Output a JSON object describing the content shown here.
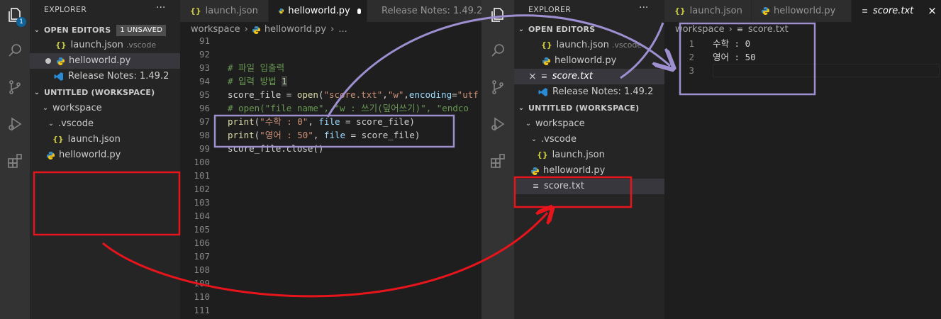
{
  "left": {
    "explorer": {
      "title": "EXPLORER",
      "more": "···"
    },
    "open_editors": {
      "label": "OPEN EDITORS",
      "badge": "1 UNSAVED",
      "items": [
        {
          "name": "launch.json",
          "hint": ".vscode"
        },
        {
          "name": "helloworld.py"
        },
        {
          "name": "Release Notes: 1.49.2"
        }
      ]
    },
    "workspace": {
      "label": "UNTITLED (WORKSPACE)",
      "items": [
        {
          "name": "workspace"
        },
        {
          "name": ".vscode"
        },
        {
          "name": "launch.json"
        },
        {
          "name": "helloworld.py"
        }
      ]
    },
    "activity_badge": "1",
    "tabs": [
      {
        "label": "launch.json"
      },
      {
        "label": "helloworld.py"
      },
      {
        "label": "Release Notes: 1.49.2"
      }
    ],
    "breadcrumb": {
      "folder": "workspace",
      "file": "helloworld.py",
      "tail": "..."
    },
    "line_numbers": [
      "91",
      "92",
      "93",
      "94",
      "95",
      "96",
      "97",
      "98",
      "99",
      "100",
      "101",
      "102",
      "103",
      "104",
      "105",
      "106",
      "107",
      "108",
      "109",
      "110",
      "111"
    ],
    "code": {
      "l93": "# 파일 입출력",
      "l94a": "# 입력 방법 ",
      "l94b": "1",
      "l95a": "score_file = ",
      "l95b": "open",
      "l95c": "(",
      "l95d": "\"score.txt\"",
      "l95e": ",",
      "l95f": "\"w\"",
      "l95g": ",",
      "l95h": "encoding",
      "l95i": "=",
      "l95j": "\"utf",
      "l96": "# open(\"file name\", \"w : 쓰기(덮어쓰기)\", \"endco",
      "l97a": "print",
      "l97b": "(",
      "l97c": "\"수학 : 0\"",
      "l97d": ", ",
      "l97e": "file",
      "l97f": " = ",
      "l97g": "score_file",
      "l97h": ")",
      "l98a": "print",
      "l98b": "(",
      "l98c": "\"영어 : 50\"",
      "l98d": ", ",
      "l98e": "file",
      "l98f": " = ",
      "l98g": "score_file",
      "l98h": ")",
      "l99": "score_file.close()"
    }
  },
  "right": {
    "explorer": {
      "title": "EXPLORER",
      "more": "···"
    },
    "open_editors": {
      "label": "OPEN EDITORS",
      "items": [
        {
          "name": "launch.json",
          "hint": ".vscode"
        },
        {
          "name": "helloworld.py"
        },
        {
          "name": "score.txt",
          "close": "×"
        },
        {
          "name": "Release Notes: 1.49.2"
        }
      ]
    },
    "workspace": {
      "label": "UNTITLED (WORKSPACE)",
      "items": [
        {
          "name": "workspace"
        },
        {
          "name": ".vscode"
        },
        {
          "name": "launch.json"
        },
        {
          "name": "helloworld.py"
        },
        {
          "name": "score.txt"
        }
      ]
    },
    "tabs": [
      {
        "label": "launch.json"
      },
      {
        "label": "helloworld.py"
      },
      {
        "label": "score.txt",
        "close": "×"
      }
    ],
    "breadcrumb": {
      "folder": "workspace",
      "file": "score.txt"
    },
    "line_numbers": [
      "1",
      "2",
      "3"
    ],
    "lines": [
      "수학 : 0",
      "영어 : 50",
      ""
    ]
  },
  "colors": {
    "annotation_red": "#e8141c",
    "annotation_purple": "#9d8fd0",
    "accent": "#0e639c"
  }
}
